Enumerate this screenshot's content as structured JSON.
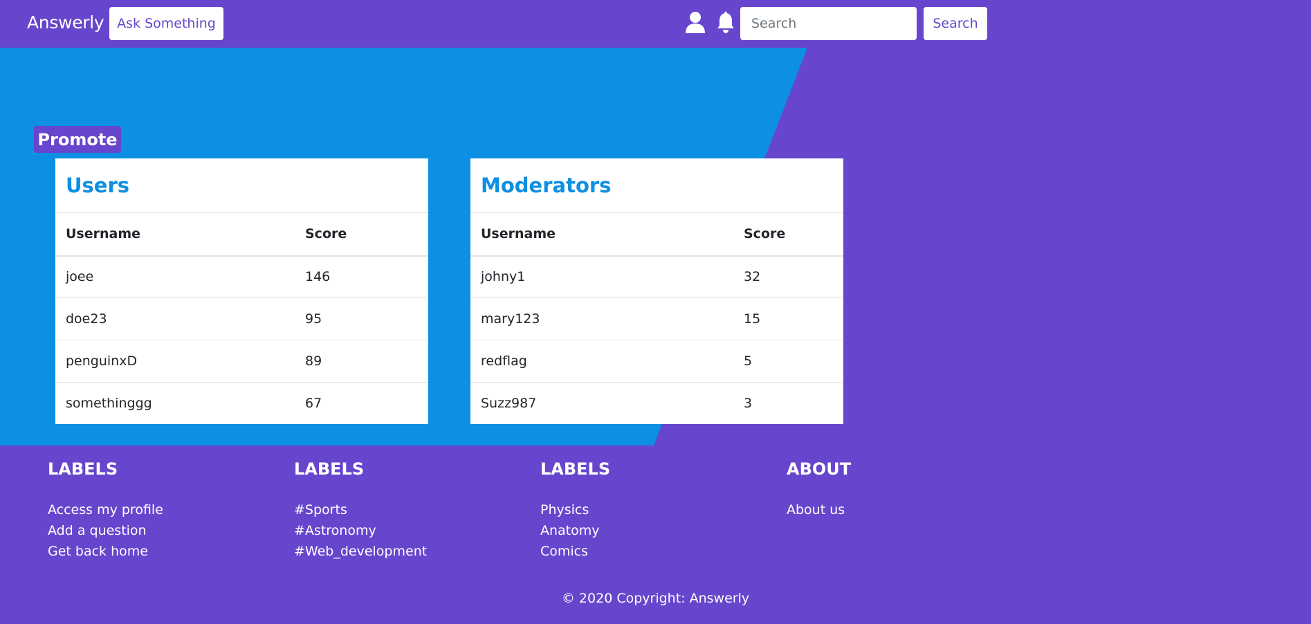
{
  "navbar": {
    "brand": "Answerly",
    "ask_label": "Ask Something",
    "user_icon": "user-icon",
    "bell_icon": "bell-icon",
    "search_placeholder": "Search",
    "search_value": "",
    "search_button": "Search"
  },
  "colors": {
    "brand_purple": "#6745cc",
    "hero_blue": "#0d8fe3",
    "card_bg": "#ffffff"
  },
  "promote": {
    "label": "Promote"
  },
  "users_table": {
    "title": "Users",
    "headers": [
      "Username",
      "Score"
    ],
    "rows": [
      [
        "joee",
        "146"
      ],
      [
        "doe23",
        "95"
      ],
      [
        "penguinxD",
        "89"
      ],
      [
        "somethinggg",
        "67"
      ]
    ]
  },
  "moderators_table": {
    "title": "Moderators",
    "headers": [
      "Username",
      "Score"
    ],
    "rows": [
      [
        "johny1",
        "32"
      ],
      [
        "mary123",
        "15"
      ],
      [
        "redflag",
        "5"
      ],
      [
        "Suzz987",
        "3"
      ]
    ]
  },
  "footer": {
    "columns": [
      {
        "heading": "LABELS",
        "links": [
          "Access my profile",
          "Add a question",
          "Get back home"
        ]
      },
      {
        "heading": "LABELS",
        "links": [
          "#Sports",
          "#Astronomy",
          "#Web_development"
        ]
      },
      {
        "heading": "LABELS",
        "links": [
          "Physics",
          "Anatomy",
          "Comics"
        ]
      },
      {
        "heading": "ABOUT",
        "links": [
          "About us"
        ]
      }
    ],
    "copyright": "© 2020 Copyright: Answerly"
  }
}
